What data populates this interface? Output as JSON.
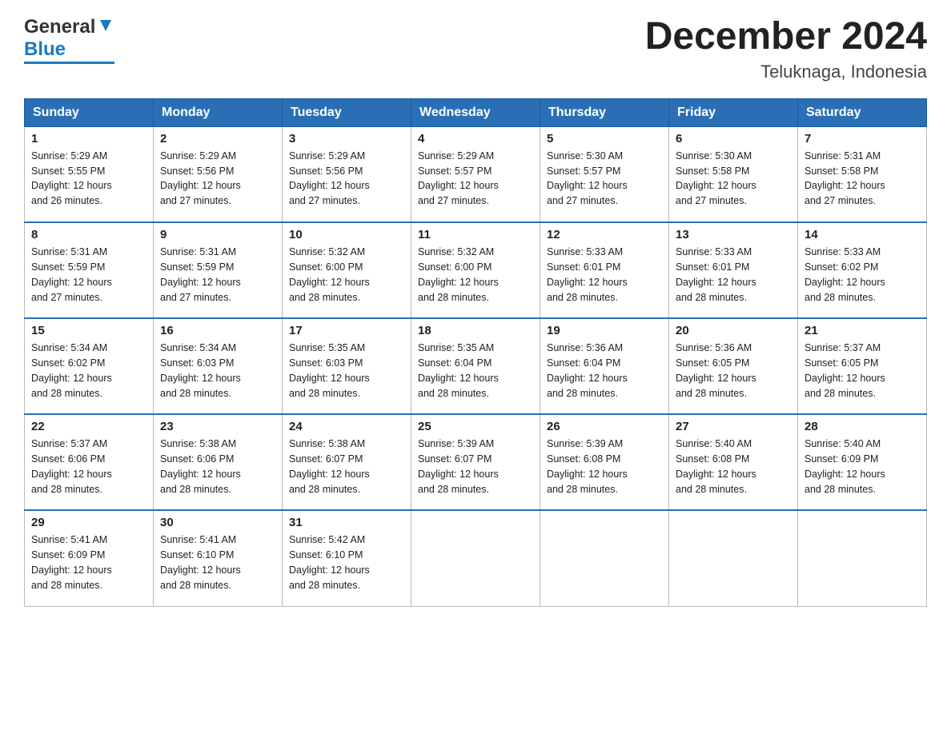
{
  "header": {
    "logo_general": "General",
    "logo_blue": "Blue",
    "title": "December 2024",
    "subtitle": "Teluknaga, Indonesia"
  },
  "calendar": {
    "days_of_week": [
      "Sunday",
      "Monday",
      "Tuesday",
      "Wednesday",
      "Thursday",
      "Friday",
      "Saturday"
    ],
    "weeks": [
      [
        {
          "day": "1",
          "sunrise": "5:29 AM",
          "sunset": "5:55 PM",
          "daylight": "12 hours and 26 minutes."
        },
        {
          "day": "2",
          "sunrise": "5:29 AM",
          "sunset": "5:56 PM",
          "daylight": "12 hours and 27 minutes."
        },
        {
          "day": "3",
          "sunrise": "5:29 AM",
          "sunset": "5:56 PM",
          "daylight": "12 hours and 27 minutes."
        },
        {
          "day": "4",
          "sunrise": "5:29 AM",
          "sunset": "5:57 PM",
          "daylight": "12 hours and 27 minutes."
        },
        {
          "day": "5",
          "sunrise": "5:30 AM",
          "sunset": "5:57 PM",
          "daylight": "12 hours and 27 minutes."
        },
        {
          "day": "6",
          "sunrise": "5:30 AM",
          "sunset": "5:58 PM",
          "daylight": "12 hours and 27 minutes."
        },
        {
          "day": "7",
          "sunrise": "5:31 AM",
          "sunset": "5:58 PM",
          "daylight": "12 hours and 27 minutes."
        }
      ],
      [
        {
          "day": "8",
          "sunrise": "5:31 AM",
          "sunset": "5:59 PM",
          "daylight": "12 hours and 27 minutes."
        },
        {
          "day": "9",
          "sunrise": "5:31 AM",
          "sunset": "5:59 PM",
          "daylight": "12 hours and 27 minutes."
        },
        {
          "day": "10",
          "sunrise": "5:32 AM",
          "sunset": "6:00 PM",
          "daylight": "12 hours and 28 minutes."
        },
        {
          "day": "11",
          "sunrise": "5:32 AM",
          "sunset": "6:00 PM",
          "daylight": "12 hours and 28 minutes."
        },
        {
          "day": "12",
          "sunrise": "5:33 AM",
          "sunset": "6:01 PM",
          "daylight": "12 hours and 28 minutes."
        },
        {
          "day": "13",
          "sunrise": "5:33 AM",
          "sunset": "6:01 PM",
          "daylight": "12 hours and 28 minutes."
        },
        {
          "day": "14",
          "sunrise": "5:33 AM",
          "sunset": "6:02 PM",
          "daylight": "12 hours and 28 minutes."
        }
      ],
      [
        {
          "day": "15",
          "sunrise": "5:34 AM",
          "sunset": "6:02 PM",
          "daylight": "12 hours and 28 minutes."
        },
        {
          "day": "16",
          "sunrise": "5:34 AM",
          "sunset": "6:03 PM",
          "daylight": "12 hours and 28 minutes."
        },
        {
          "day": "17",
          "sunrise": "5:35 AM",
          "sunset": "6:03 PM",
          "daylight": "12 hours and 28 minutes."
        },
        {
          "day": "18",
          "sunrise": "5:35 AM",
          "sunset": "6:04 PM",
          "daylight": "12 hours and 28 minutes."
        },
        {
          "day": "19",
          "sunrise": "5:36 AM",
          "sunset": "6:04 PM",
          "daylight": "12 hours and 28 minutes."
        },
        {
          "day": "20",
          "sunrise": "5:36 AM",
          "sunset": "6:05 PM",
          "daylight": "12 hours and 28 minutes."
        },
        {
          "day": "21",
          "sunrise": "5:37 AM",
          "sunset": "6:05 PM",
          "daylight": "12 hours and 28 minutes."
        }
      ],
      [
        {
          "day": "22",
          "sunrise": "5:37 AM",
          "sunset": "6:06 PM",
          "daylight": "12 hours and 28 minutes."
        },
        {
          "day": "23",
          "sunrise": "5:38 AM",
          "sunset": "6:06 PM",
          "daylight": "12 hours and 28 minutes."
        },
        {
          "day": "24",
          "sunrise": "5:38 AM",
          "sunset": "6:07 PM",
          "daylight": "12 hours and 28 minutes."
        },
        {
          "day": "25",
          "sunrise": "5:39 AM",
          "sunset": "6:07 PM",
          "daylight": "12 hours and 28 minutes."
        },
        {
          "day": "26",
          "sunrise": "5:39 AM",
          "sunset": "6:08 PM",
          "daylight": "12 hours and 28 minutes."
        },
        {
          "day": "27",
          "sunrise": "5:40 AM",
          "sunset": "6:08 PM",
          "daylight": "12 hours and 28 minutes."
        },
        {
          "day": "28",
          "sunrise": "5:40 AM",
          "sunset": "6:09 PM",
          "daylight": "12 hours and 28 minutes."
        }
      ],
      [
        {
          "day": "29",
          "sunrise": "5:41 AM",
          "sunset": "6:09 PM",
          "daylight": "12 hours and 28 minutes."
        },
        {
          "day": "30",
          "sunrise": "5:41 AM",
          "sunset": "6:10 PM",
          "daylight": "12 hours and 28 minutes."
        },
        {
          "day": "31",
          "sunrise": "5:42 AM",
          "sunset": "6:10 PM",
          "daylight": "12 hours and 28 minutes."
        },
        null,
        null,
        null,
        null
      ]
    ],
    "labels": {
      "sunrise": "Sunrise:",
      "sunset": "Sunset:",
      "daylight": "Daylight:"
    }
  }
}
